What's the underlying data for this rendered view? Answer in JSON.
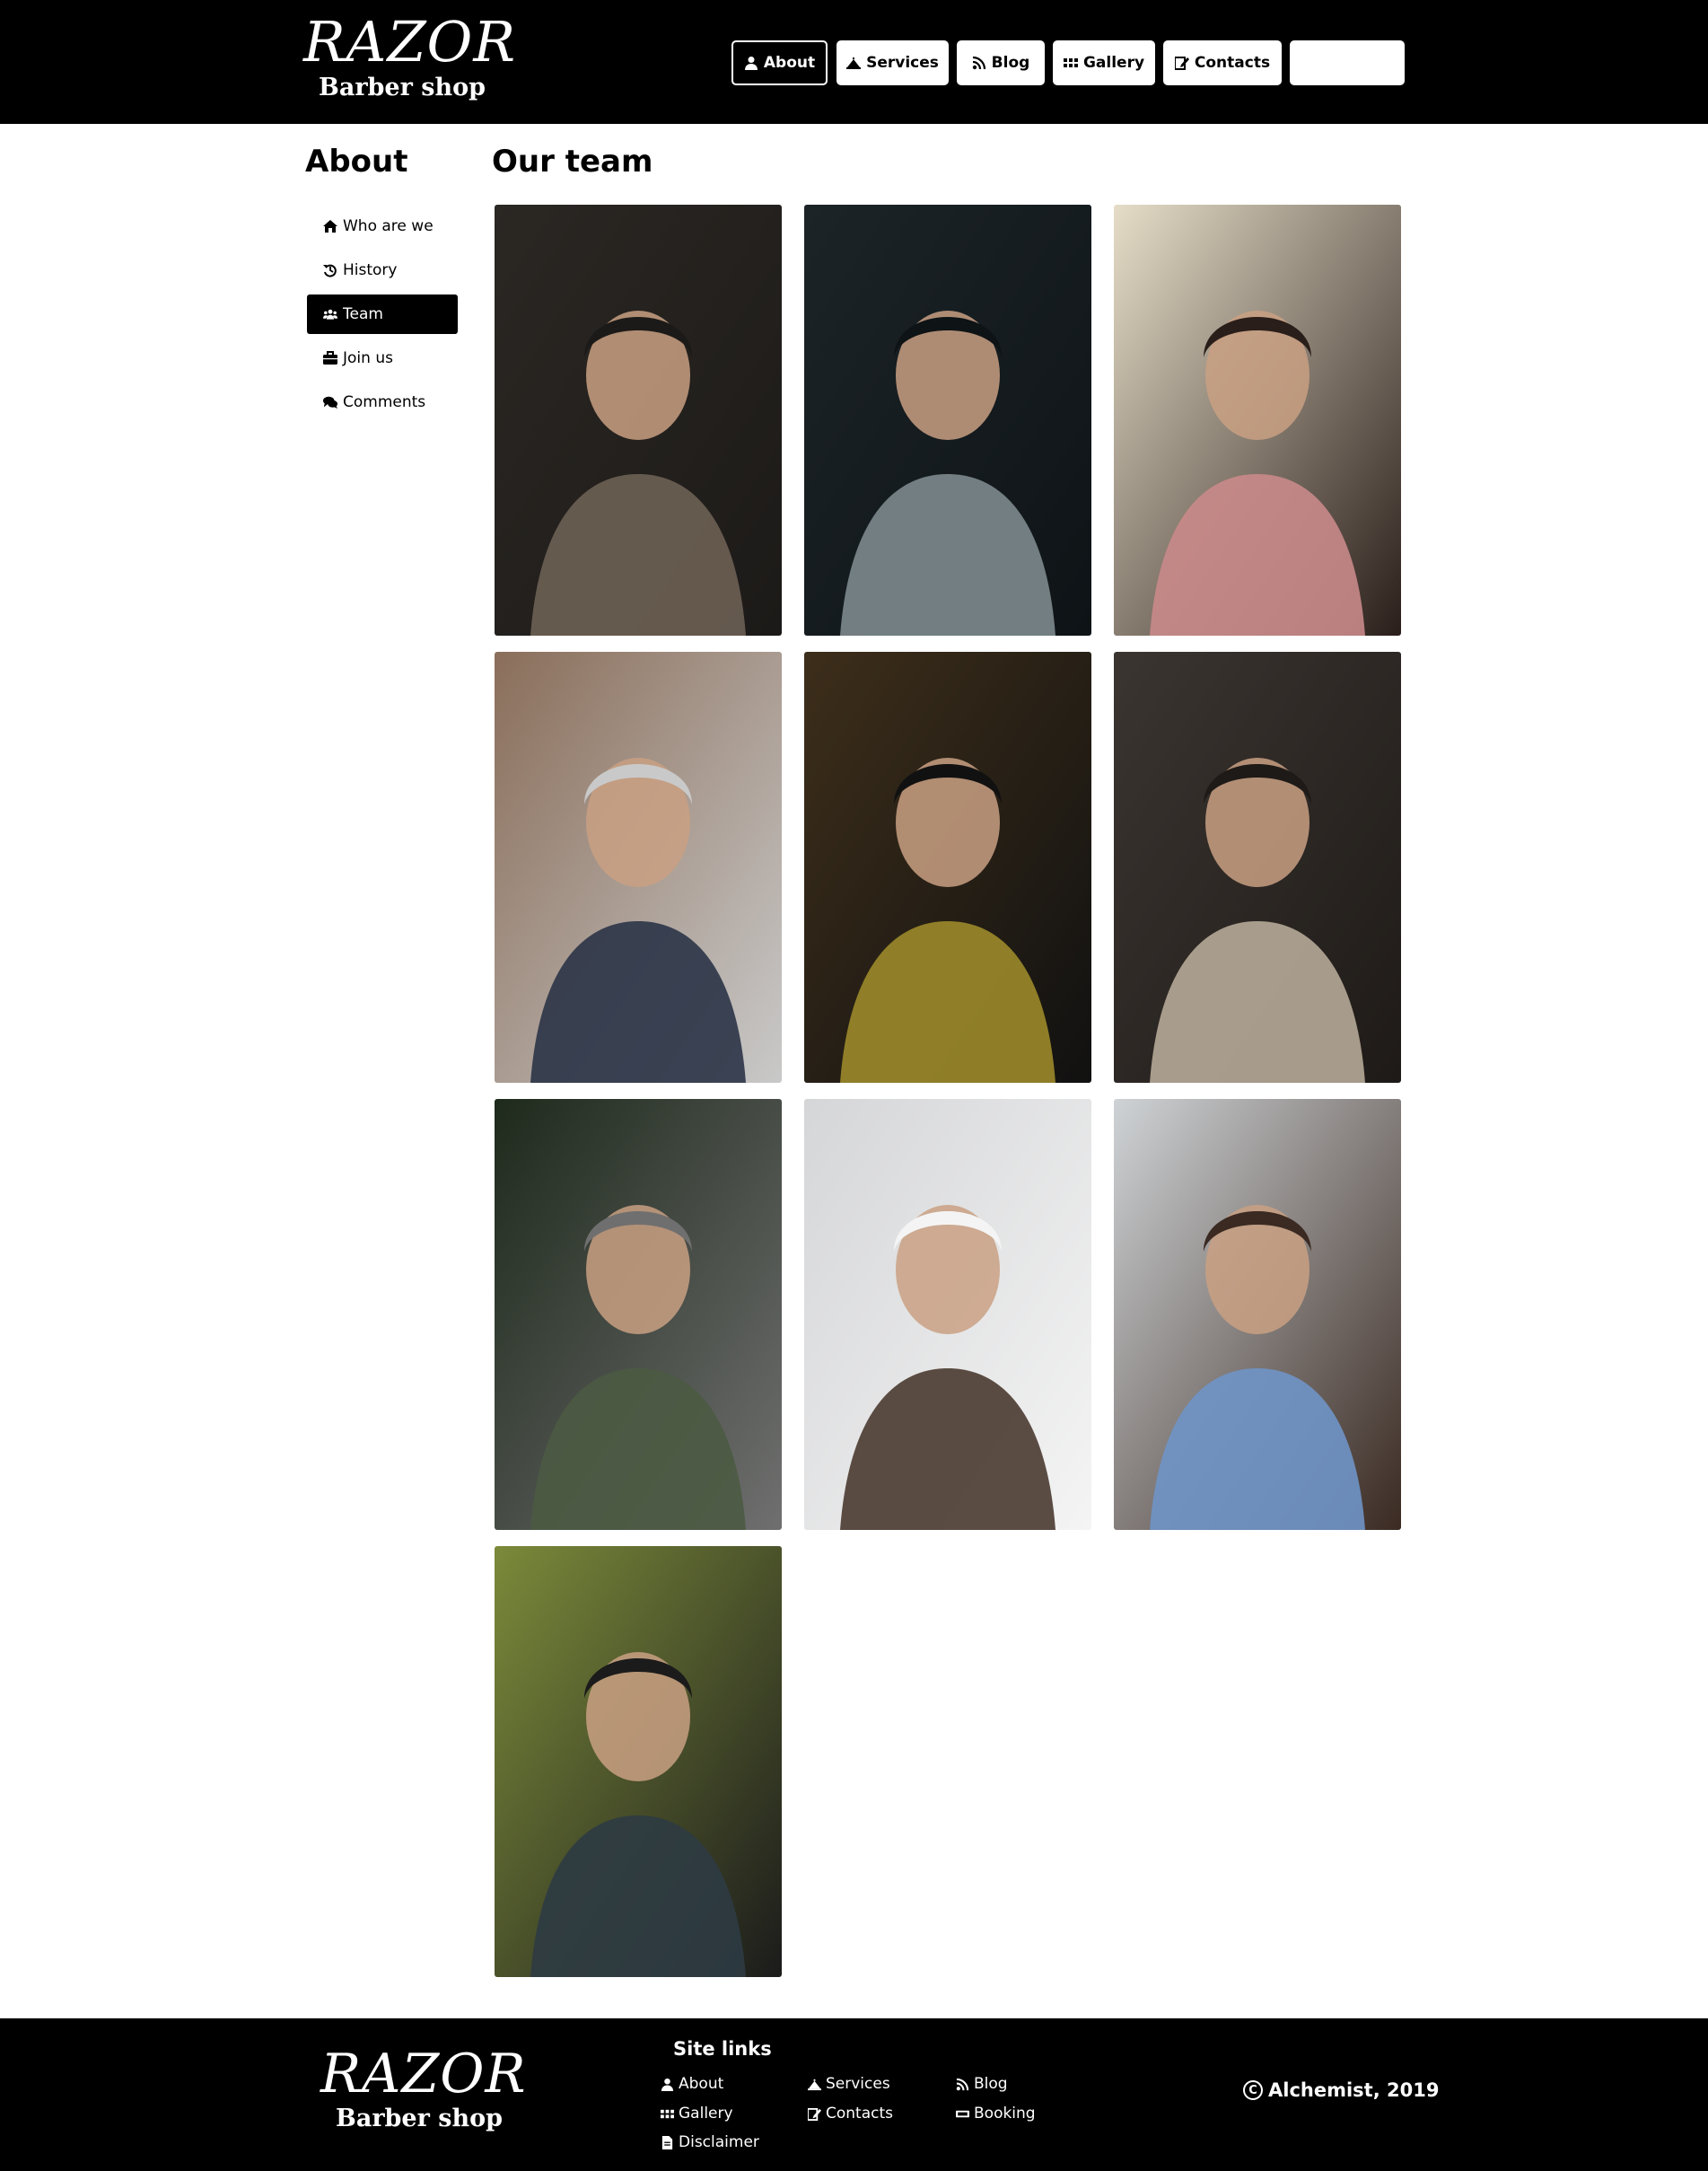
{
  "brand": {
    "name": "RAZOR",
    "tagline": "Barber shop"
  },
  "topnav": [
    {
      "label": "About",
      "icon": "user-icon",
      "active": true
    },
    {
      "label": "Services",
      "icon": "bell-icon",
      "active": false
    },
    {
      "label": "Blog",
      "icon": "rss-icon",
      "active": false
    },
    {
      "label": "Gallery",
      "icon": "grid-icon",
      "active": false
    },
    {
      "label": "Contacts",
      "icon": "edit-icon",
      "active": false
    },
    {
      "label": "",
      "icon": "",
      "active": false
    }
  ],
  "sidebar": {
    "title": "About",
    "items": [
      {
        "label": "Who are we",
        "icon": "home-icon",
        "active": false
      },
      {
        "label": "History",
        "icon": "history-icon",
        "active": false
      },
      {
        "label": "Team",
        "icon": "users-icon",
        "active": true
      },
      {
        "label": "Join us",
        "icon": "briefcase-icon",
        "active": false
      },
      {
        "label": "Comments",
        "icon": "comments-icon",
        "active": false
      }
    ]
  },
  "main": {
    "title": "Our team",
    "photos": [
      {
        "name": "team-photo-1",
        "colors": [
          "#2b2723",
          "#6d6054",
          "#1c1a18"
        ]
      },
      {
        "name": "team-photo-2",
        "colors": [
          "#1c2428",
          "#7d8a8e",
          "#0e1316"
        ]
      },
      {
        "name": "team-photo-3",
        "colors": [
          "#e6ddc8",
          "#c98a8a",
          "#2a1e1a"
        ]
      },
      {
        "name": "team-photo-4",
        "colors": [
          "#8a6e5a",
          "#2b3447",
          "#c9c9c9"
        ]
      },
      {
        "name": "team-photo-5",
        "colors": [
          "#3d2e1a",
          "#9c8a2a",
          "#111111"
        ]
      },
      {
        "name": "team-photo-6",
        "colors": [
          "#3b3531",
          "#b6aa98",
          "#1e1a17"
        ]
      },
      {
        "name": "team-photo-7",
        "colors": [
          "#1e2a1c",
          "#4b5a42",
          "#6f6f6f"
        ]
      },
      {
        "name": "team-photo-8",
        "colors": [
          "#d5d6d8",
          "#4a3a30",
          "#f4f4f4"
        ]
      },
      {
        "name": "team-photo-9",
        "colors": [
          "#cfd3d6",
          "#6f93c7",
          "#3a2a22"
        ]
      },
      {
        "name": "team-photo-10",
        "colors": [
          "#7b8a3a",
          "#2e3b43",
          "#1b1b1b"
        ]
      }
    ]
  },
  "footer": {
    "site_links_title": "Site links",
    "links": [
      {
        "label": "About",
        "icon": "user-icon"
      },
      {
        "label": "Services",
        "icon": "bell-icon"
      },
      {
        "label": "Blog",
        "icon": "rss-icon"
      },
      {
        "label": "Gallery",
        "icon": "grid-icon"
      },
      {
        "label": "Contacts",
        "icon": "edit-icon"
      },
      {
        "label": "Booking",
        "icon": "ticket-icon"
      },
      {
        "label": "Disclaimer",
        "icon": "document-icon"
      }
    ],
    "copyright": "Alchemist, 2019"
  }
}
